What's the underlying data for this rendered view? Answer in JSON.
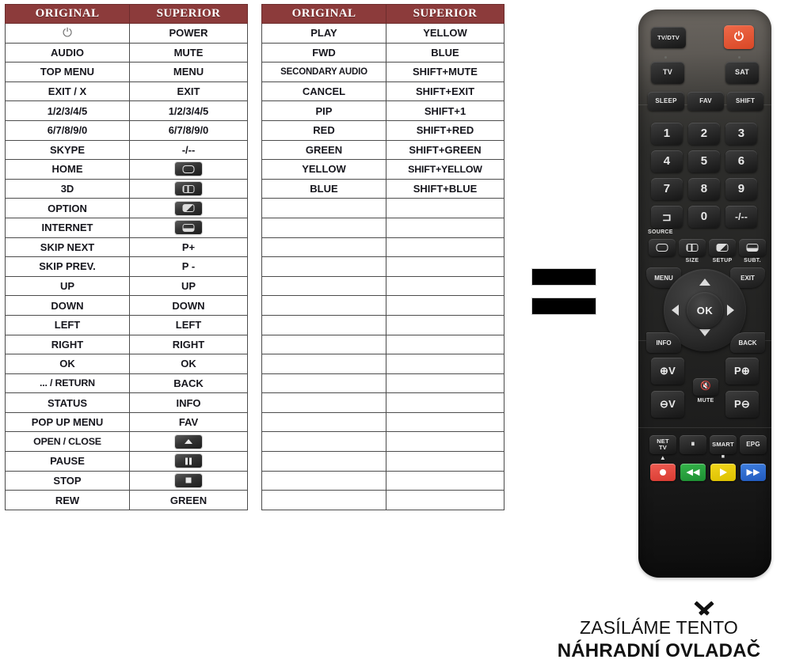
{
  "tables": [
    {
      "id": "table-one",
      "headers": [
        "ORIGINAL",
        "SUPERIOR"
      ],
      "rows": [
        {
          "original": "",
          "original_icon": "power-icon",
          "superior": "POWER"
        },
        {
          "original": "AUDIO",
          "superior": "MUTE"
        },
        {
          "original": "TOP MENU",
          "superior": "MENU"
        },
        {
          "original": "EXIT / X",
          "superior": "EXIT"
        },
        {
          "original": "1/2/3/4/5",
          "superior": "1/2/3/4/5"
        },
        {
          "original": "6/7/8/9/0",
          "superior": "6/7/8/9/0"
        },
        {
          "original": "SKYPE",
          "superior": "-/--"
        },
        {
          "original": "HOME",
          "superior": "",
          "superior_icon": "screen-key-icon"
        },
        {
          "original": "3D",
          "superior": "",
          "superior_icon": "size-key-icon"
        },
        {
          "original": "OPTION",
          "superior": "",
          "superior_icon": "setup-key-icon"
        },
        {
          "original": "INTERNET",
          "superior": "",
          "superior_icon": "subtitle-key-icon"
        },
        {
          "original": "SKIP NEXT",
          "superior": "P+"
        },
        {
          "original": "SKIP PREV.",
          "superior": "P -"
        },
        {
          "original": "UP",
          "superior": "UP"
        },
        {
          "original": "DOWN",
          "superior": "DOWN"
        },
        {
          "original": "LEFT",
          "superior": "LEFT"
        },
        {
          "original": "RIGHT",
          "superior": "RIGHT"
        },
        {
          "original": "OK",
          "superior": "OK"
        },
        {
          "original": "... / RETURN",
          "superior": "BACK"
        },
        {
          "original": "STATUS",
          "superior": "INFO"
        },
        {
          "original": "POP UP MENU",
          "superior": "FAV"
        },
        {
          "original": "OPEN / CLOSE",
          "superior": "",
          "superior_icon": "eject-key-icon"
        },
        {
          "original": "PAUSE",
          "superior": "",
          "superior_icon": "pause-key-icon"
        },
        {
          "original": "STOP",
          "superior": "",
          "superior_icon": "stop-key-icon"
        },
        {
          "original": "REW",
          "superior": "GREEN"
        }
      ]
    },
    {
      "id": "table-two",
      "headers": [
        "ORIGINAL",
        "SUPERIOR"
      ],
      "rows": [
        {
          "original": "PLAY",
          "superior": "YELLOW"
        },
        {
          "original": "FWD",
          "superior": "BLUE"
        },
        {
          "original": "SECONDARY AUDIO",
          "superior": "SHIFT+MUTE"
        },
        {
          "original": "CANCEL",
          "superior": "SHIFT+EXIT"
        },
        {
          "original": "PIP",
          "superior": "SHIFT+1"
        },
        {
          "original": "RED",
          "superior": "SHIFT+RED"
        },
        {
          "original": "GREEN",
          "superior": "SHIFT+GREEN"
        },
        {
          "original": "YELLOW",
          "superior": "SHIFT+YELLOW"
        },
        {
          "original": "BLUE",
          "superior": "SHIFT+BLUE"
        },
        {
          "original": "",
          "superior": ""
        },
        {
          "original": "",
          "superior": ""
        },
        {
          "original": "",
          "superior": ""
        },
        {
          "original": "",
          "superior": ""
        },
        {
          "original": "",
          "superior": ""
        },
        {
          "original": "",
          "superior": ""
        },
        {
          "original": "",
          "superior": ""
        },
        {
          "original": "",
          "superior": ""
        },
        {
          "original": "",
          "superior": ""
        },
        {
          "original": "",
          "superior": ""
        },
        {
          "original": "",
          "superior": ""
        },
        {
          "original": "",
          "superior": ""
        },
        {
          "original": "",
          "superior": ""
        },
        {
          "original": "",
          "superior": ""
        },
        {
          "original": "",
          "superior": ""
        },
        {
          "original": "",
          "superior": ""
        }
      ]
    }
  ],
  "equals": {
    "symbol": "="
  },
  "remote": {
    "buttons": {
      "tv_dtv": "TV/DTV",
      "power": "power-icon",
      "tv": "TV",
      "sat": "SAT",
      "sleep": "SLEEP",
      "fav": "FAV",
      "shift": "SHIFT",
      "n1": "1",
      "n2": "2",
      "n3": "3",
      "n4": "4",
      "n5": "5",
      "n6": "6",
      "n7": "7",
      "n8": "8",
      "n9": "9",
      "source": "SOURCE",
      "n0": "0",
      "dash": "-/--",
      "size": "SIZE",
      "setup": "SETUP",
      "subt": "SUBT.",
      "menu": "MENU",
      "exit": "EXIT",
      "ok": "OK",
      "info": "INFO",
      "back": "BACK",
      "vol_up": "V",
      "vol_down": "V",
      "mute": "MUTE",
      "prog_up": "P",
      "prog_down": "P",
      "net_tv": "NET\nTV",
      "pause": "pause-icon",
      "smart": "SMART",
      "epg": "EPG",
      "record": "record-icon",
      "rewind": "rewind-icon",
      "play": "play-icon",
      "forward": "forward-icon"
    },
    "colors": {
      "power_button": "#e2502c",
      "record": "#e2493f",
      "rewind": "#25a03a",
      "play": "#eccb09",
      "forward": "#2f63c8",
      "body": "#222222"
    }
  },
  "caption": {
    "line1": "ZASÍLÁME TENTO",
    "line2": "NÁHRADNÍ OVLADAČ"
  }
}
